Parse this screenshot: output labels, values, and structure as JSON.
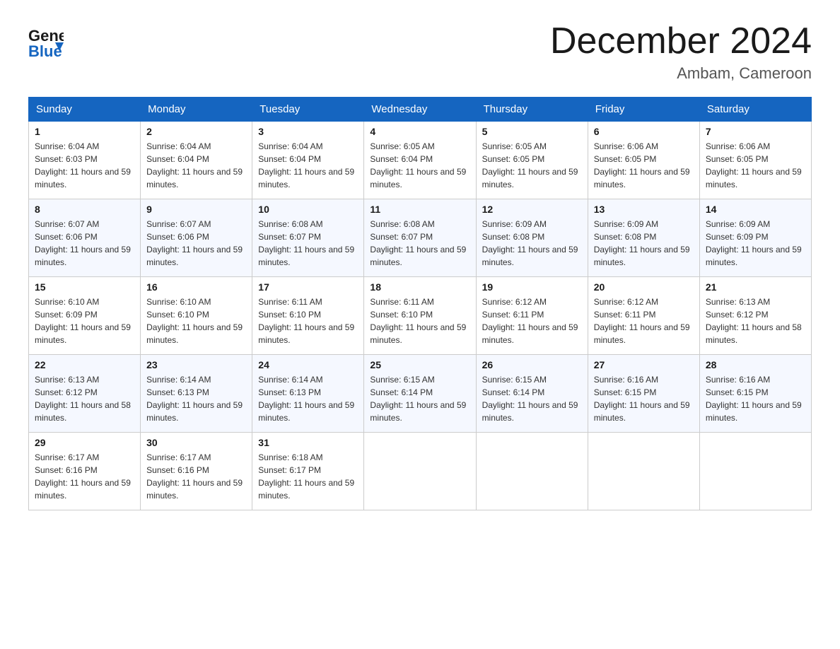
{
  "header": {
    "logo_general": "General",
    "logo_blue": "Blue",
    "month_title": "December 2024",
    "location": "Ambam, Cameroon"
  },
  "weekdays": [
    "Sunday",
    "Monday",
    "Tuesday",
    "Wednesday",
    "Thursday",
    "Friday",
    "Saturday"
  ],
  "weeks": [
    [
      {
        "day": "1",
        "sunrise": "6:04 AM",
        "sunset": "6:03 PM",
        "daylight": "11 hours and 59 minutes."
      },
      {
        "day": "2",
        "sunrise": "6:04 AM",
        "sunset": "6:04 PM",
        "daylight": "11 hours and 59 minutes."
      },
      {
        "day": "3",
        "sunrise": "6:04 AM",
        "sunset": "6:04 PM",
        "daylight": "11 hours and 59 minutes."
      },
      {
        "day": "4",
        "sunrise": "6:05 AM",
        "sunset": "6:04 PM",
        "daylight": "11 hours and 59 minutes."
      },
      {
        "day": "5",
        "sunrise": "6:05 AM",
        "sunset": "6:05 PM",
        "daylight": "11 hours and 59 minutes."
      },
      {
        "day": "6",
        "sunrise": "6:06 AM",
        "sunset": "6:05 PM",
        "daylight": "11 hours and 59 minutes."
      },
      {
        "day": "7",
        "sunrise": "6:06 AM",
        "sunset": "6:05 PM",
        "daylight": "11 hours and 59 minutes."
      }
    ],
    [
      {
        "day": "8",
        "sunrise": "6:07 AM",
        "sunset": "6:06 PM",
        "daylight": "11 hours and 59 minutes."
      },
      {
        "day": "9",
        "sunrise": "6:07 AM",
        "sunset": "6:06 PM",
        "daylight": "11 hours and 59 minutes."
      },
      {
        "day": "10",
        "sunrise": "6:08 AM",
        "sunset": "6:07 PM",
        "daylight": "11 hours and 59 minutes."
      },
      {
        "day": "11",
        "sunrise": "6:08 AM",
        "sunset": "6:07 PM",
        "daylight": "11 hours and 59 minutes."
      },
      {
        "day": "12",
        "sunrise": "6:09 AM",
        "sunset": "6:08 PM",
        "daylight": "11 hours and 59 minutes."
      },
      {
        "day": "13",
        "sunrise": "6:09 AM",
        "sunset": "6:08 PM",
        "daylight": "11 hours and 59 minutes."
      },
      {
        "day": "14",
        "sunrise": "6:09 AM",
        "sunset": "6:09 PM",
        "daylight": "11 hours and 59 minutes."
      }
    ],
    [
      {
        "day": "15",
        "sunrise": "6:10 AM",
        "sunset": "6:09 PM",
        "daylight": "11 hours and 59 minutes."
      },
      {
        "day": "16",
        "sunrise": "6:10 AM",
        "sunset": "6:10 PM",
        "daylight": "11 hours and 59 minutes."
      },
      {
        "day": "17",
        "sunrise": "6:11 AM",
        "sunset": "6:10 PM",
        "daylight": "11 hours and 59 minutes."
      },
      {
        "day": "18",
        "sunrise": "6:11 AM",
        "sunset": "6:10 PM",
        "daylight": "11 hours and 59 minutes."
      },
      {
        "day": "19",
        "sunrise": "6:12 AM",
        "sunset": "6:11 PM",
        "daylight": "11 hours and 59 minutes."
      },
      {
        "day": "20",
        "sunrise": "6:12 AM",
        "sunset": "6:11 PM",
        "daylight": "11 hours and 59 minutes."
      },
      {
        "day": "21",
        "sunrise": "6:13 AM",
        "sunset": "6:12 PM",
        "daylight": "11 hours and 58 minutes."
      }
    ],
    [
      {
        "day": "22",
        "sunrise": "6:13 AM",
        "sunset": "6:12 PM",
        "daylight": "11 hours and 58 minutes."
      },
      {
        "day": "23",
        "sunrise": "6:14 AM",
        "sunset": "6:13 PM",
        "daylight": "11 hours and 59 minutes."
      },
      {
        "day": "24",
        "sunrise": "6:14 AM",
        "sunset": "6:13 PM",
        "daylight": "11 hours and 59 minutes."
      },
      {
        "day": "25",
        "sunrise": "6:15 AM",
        "sunset": "6:14 PM",
        "daylight": "11 hours and 59 minutes."
      },
      {
        "day": "26",
        "sunrise": "6:15 AM",
        "sunset": "6:14 PM",
        "daylight": "11 hours and 59 minutes."
      },
      {
        "day": "27",
        "sunrise": "6:16 AM",
        "sunset": "6:15 PM",
        "daylight": "11 hours and 59 minutes."
      },
      {
        "day": "28",
        "sunrise": "6:16 AM",
        "sunset": "6:15 PM",
        "daylight": "11 hours and 59 minutes."
      }
    ],
    [
      {
        "day": "29",
        "sunrise": "6:17 AM",
        "sunset": "6:16 PM",
        "daylight": "11 hours and 59 minutes."
      },
      {
        "day": "30",
        "sunrise": "6:17 AM",
        "sunset": "6:16 PM",
        "daylight": "11 hours and 59 minutes."
      },
      {
        "day": "31",
        "sunrise": "6:18 AM",
        "sunset": "6:17 PM",
        "daylight": "11 hours and 59 minutes."
      },
      null,
      null,
      null,
      null
    ]
  ]
}
